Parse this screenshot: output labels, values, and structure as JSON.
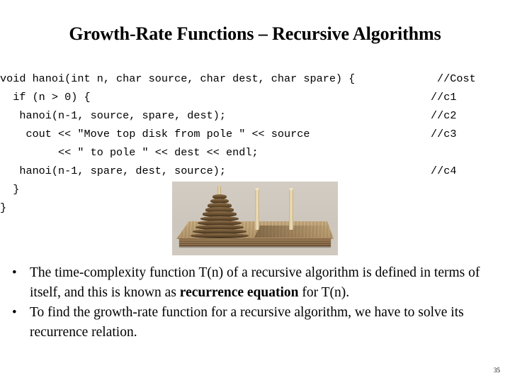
{
  "slide": {
    "title": "Growth-Rate Functions – Recursive Algorithms",
    "page_number": "35",
    "background_color": "#ffffff",
    "text_color": "#000000"
  },
  "code": {
    "language": "cpp",
    "lines": [
      {
        "text": "void hanoi(int n, char source, char dest, char spare) {",
        "comment": "//Cost"
      },
      {
        "text": "  if (n > 0) {",
        "comment": "//c1"
      },
      {
        "text": "   hanoi(n-1, source, spare, dest);",
        "comment": "//c2"
      },
      {
        "text": "    cout << \"Move top disk from pole \" << source",
        "comment": "//c3"
      },
      {
        "text": "         << \" to pole \" << dest << endl;",
        "comment": ""
      },
      {
        "text": "   hanoi(n-1, spare, dest, source);",
        "comment": "//c4"
      },
      {
        "text": "  }",
        "comment": ""
      },
      {
        "text": "}",
        "comment": ""
      }
    ]
  },
  "figure": {
    "name": "tower-of-hanoi-photo",
    "alt": "Wooden Tower of Hanoi puzzle with a stack of disks on the left peg and two empty pegs",
    "disk_count": 10,
    "peg_count": 3,
    "colors": {
      "disk_dark": "#4e3a22",
      "disk_light": "#8d6f4a",
      "peg": "#e6d7b2",
      "base": "#bb9f72",
      "photo_background": "#cdc7be"
    }
  },
  "bullets": [
    {
      "marker": "•",
      "parts": [
        {
          "text": "The time-complexity function T(n) of a recursive algorithm is defined in terms of itself, and this is known as ",
          "bold": false
        },
        {
          "text": "recurrence equation",
          "bold": true
        },
        {
          "text": " for T(n).",
          "bold": false
        }
      ]
    },
    {
      "marker": "•",
      "parts": [
        {
          "text": "To find the growth-rate function for a recursive algorithm, we have to solve its recurrence relation.",
          "bold": false
        }
      ]
    }
  ]
}
